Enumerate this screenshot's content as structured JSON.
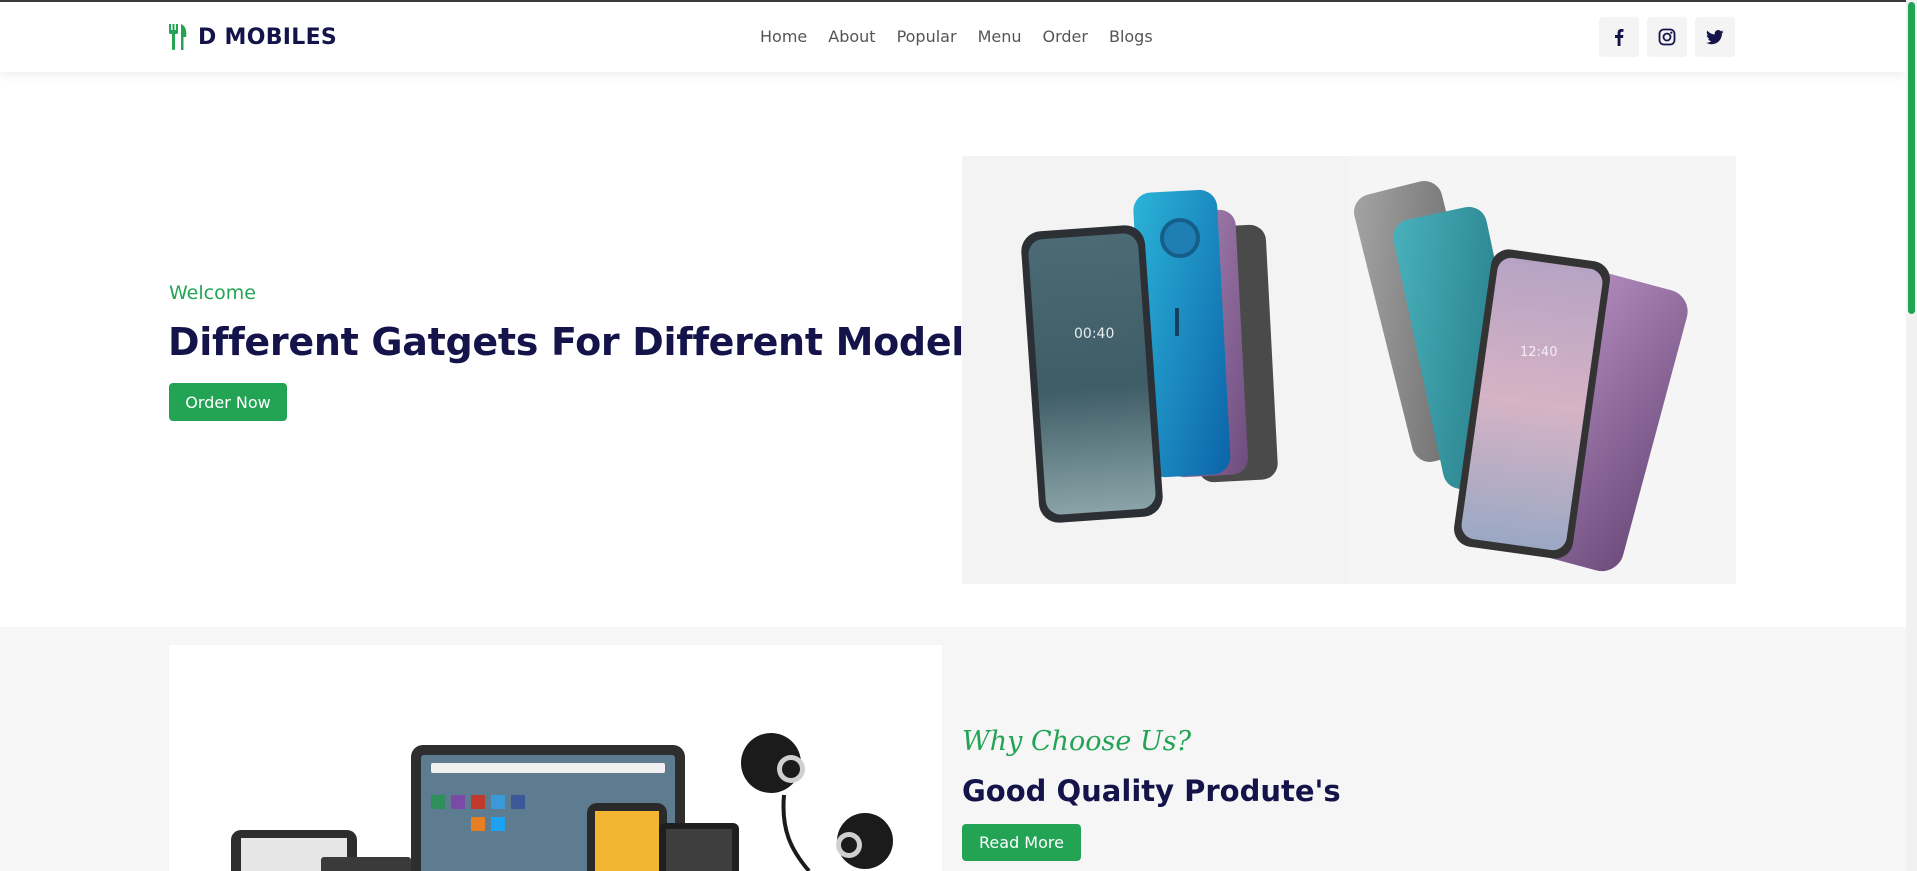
{
  "header": {
    "brand": "D MOBILES",
    "nav": [
      "Home",
      "About",
      "Popular",
      "Menu",
      "Order",
      "Blogs"
    ],
    "socials": [
      "facebook-icon",
      "instagram-icon",
      "twitter-icon"
    ]
  },
  "hero": {
    "kicker": "Welcome",
    "title": "Different Gatgets For Different Model's",
    "button": "Order Now"
  },
  "why": {
    "kicker": "Why Choose Us?",
    "title": "Good Quality Produte's",
    "button": "Read More"
  },
  "colors": {
    "accent": "#23a455",
    "heading": "#14134a",
    "section_bg": "#f6f6f6"
  }
}
